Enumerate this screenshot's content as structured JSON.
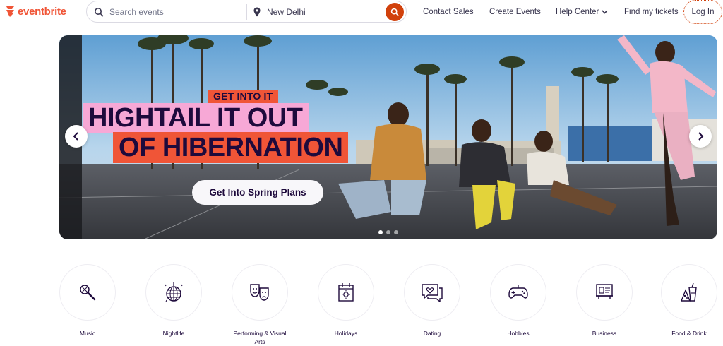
{
  "header": {
    "logo_text": "eventbrite",
    "search_placeholder": "Search events",
    "location": "New Delhi",
    "nav": {
      "contact_sales": "Contact Sales",
      "create_events": "Create Events",
      "help_center": "Help Center",
      "find_tickets": "Find my tickets",
      "login": "Log In"
    }
  },
  "hero": {
    "tag": "GET INTO IT",
    "headline_line1": "HIGHTAIL IT OUT",
    "headline_line2": "OF HIBERNATION",
    "cta": "Get Into Spring Plans"
  },
  "categories": [
    {
      "label": "Music",
      "icon": "microphone-icon"
    },
    {
      "label": "Nightlife",
      "icon": "disco-ball-icon"
    },
    {
      "label": "Performing & Visual Arts",
      "icon": "theater-masks-icon"
    },
    {
      "label": "Holidays",
      "icon": "calendar-icon"
    },
    {
      "label": "Dating",
      "icon": "chat-heart-icon"
    },
    {
      "label": "Hobbies",
      "icon": "gamepad-icon"
    },
    {
      "label": "Business",
      "icon": "presentation-board-icon"
    },
    {
      "label": "Food & Drink",
      "icon": "food-drink-icon"
    }
  ],
  "colors": {
    "brand": "#f05537",
    "search_button": "#d1410c",
    "text": "#1e0a3c",
    "pink": "#f7a8d6"
  }
}
